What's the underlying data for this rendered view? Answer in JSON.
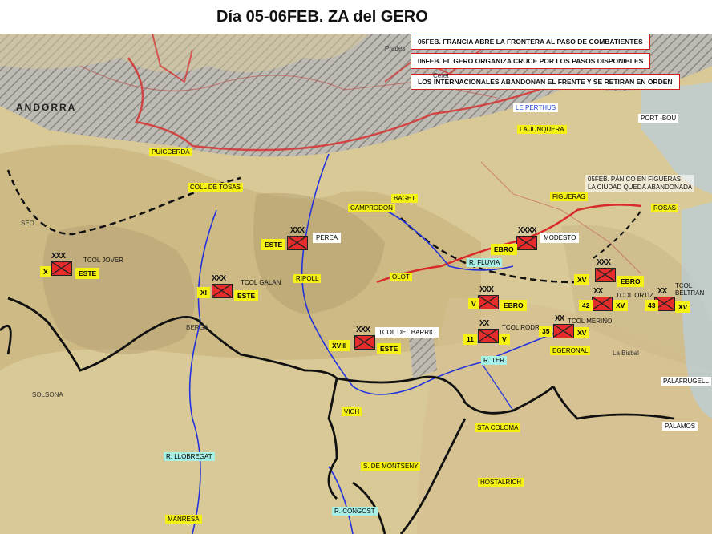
{
  "title": "Día 05-06FEB. ZA del GERO",
  "notes": [
    "05FEB. FRANCIA ABRE LA FRONTERA AL PASO DE COMBATIENTES",
    "06FEB. EL GERO ORGANIZA CRUCE POR LOS PASOS DISPONIBLES",
    "LOS INTERNACIONALES  ABANDONAN  EL FRENTE Y SE RETIRAN EN ORDEN"
  ],
  "figueras_note": "05FEB. PÁNICO EN FIGUERAS\nLA CIUDAD QUEDA ABANDONADA",
  "places": {
    "andorra": "ANDORRA",
    "le_perthus": "LE PERTHUS",
    "la_junquera": "LA JUNQUERA",
    "port_bou": "PORT -BOU",
    "puigcerda": "PUIGCERDA",
    "coll_de_tosas": "COLL DE TOSAS",
    "seo": "SEO",
    "camprodon": "CAMPRODON",
    "baget": "BAGET",
    "figueras": "FIGUERAS",
    "rosas": "ROSAS",
    "olot": "OLOT",
    "ripoll": "RIPOLL",
    "berga": "BERGA",
    "solsona": "SOLSONA",
    "vich": "VICH",
    "sta_coloma": "STA COLOMA",
    "s_de_montseny": "S. DE MONTSENY",
    "hostalrich": "HOSTALRICH",
    "manresa": "MANRESA",
    "palafrugell": "PALAFRUGELL",
    "palamos": "PALAMOS",
    "egeronal": "EGERONAL",
    "la_bisbal": "La Bisbal",
    "prades": "Prades",
    "ceret": "Ceret"
  },
  "rivers": {
    "fluvia": "R. FLUVIA",
    "ter": "R. TER",
    "llobregat": "R. LLOBREGAT",
    "congost": "R. CONGOST"
  },
  "units": {
    "u1": {
      "ech": "XXX",
      "left": "X",
      "right": "ESTE",
      "cmd": "TCOL JOVER"
    },
    "u2": {
      "ech": "XXX",
      "left": "XI",
      "right": "ESTE",
      "cmd": "TCOL GALAN"
    },
    "u3": {
      "ech": "XXX",
      "left": "ESTE",
      "right": "PEREA"
    },
    "u4": {
      "ech": "XXXX",
      "left": "EBRO",
      "right": "MODESTO"
    },
    "u5": {
      "ech": "XXX",
      "left": "XVIII",
      "right": "ESTE",
      "cmd": "TCOL DEL BARRIO"
    },
    "u6": {
      "ech": "XXX",
      "left": "V",
      "right": "EBRO"
    },
    "u7": {
      "ech": "XX",
      "left": "11",
      "right": "V",
      "cmd": "TCOL RODR"
    },
    "u8": {
      "ech": "XXX",
      "left": "XV",
      "right": "EBRO"
    },
    "u9": {
      "ech": "XX",
      "left": "42",
      "right": "XV",
      "cmd": "TCOL ORTIZ"
    },
    "u10": {
      "ech": "XX",
      "left": "43",
      "right": "XV",
      "cmd": "TCOL BELTRAN"
    },
    "u11": {
      "ech": "XX",
      "left": "35",
      "right": "XV",
      "cmd": "TCOL MERINO"
    }
  },
  "colors": {
    "unit_fill": "#e52c2c",
    "label_yellow": "#f5f016",
    "note_border": "#d21b1b",
    "river": "#2233dd",
    "front_line": "#111111",
    "border_red": "#d82a2a"
  }
}
